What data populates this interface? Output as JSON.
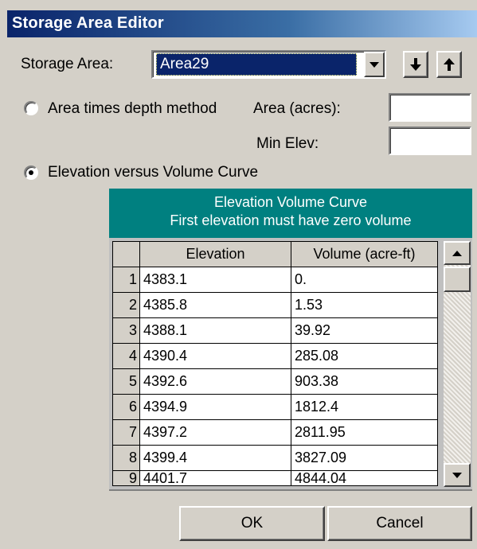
{
  "window": {
    "title": "Storage Area Editor"
  },
  "storage_area": {
    "label": "Storage Area:",
    "selected": "Area29"
  },
  "method": {
    "area_depth_label": "Area times depth method",
    "elev_volume_label": "Elevation versus Volume Curve",
    "selected": "elevation_volume"
  },
  "area_field": {
    "label": "Area (acres):",
    "value": ""
  },
  "min_elev_field": {
    "label": "Min Elev:",
    "value": ""
  },
  "grid": {
    "title_line1": "Elevation Volume Curve",
    "title_line2": "First elevation must have zero volume",
    "columns": [
      "Elevation",
      "Volume (acre-ft)"
    ],
    "rows": [
      {
        "num": "1",
        "elevation": "4383.1",
        "volume": "0."
      },
      {
        "num": "2",
        "elevation": "4385.8",
        "volume": "1.53"
      },
      {
        "num": "3",
        "elevation": "4388.1",
        "volume": "39.92"
      },
      {
        "num": "4",
        "elevation": "4390.4",
        "volume": "285.08"
      },
      {
        "num": "5",
        "elevation": "4392.6",
        "volume": "903.38"
      },
      {
        "num": "6",
        "elevation": "4394.9",
        "volume": "1812.4"
      },
      {
        "num": "7",
        "elevation": "4397.2",
        "volume": "2811.95"
      },
      {
        "num": "8",
        "elevation": "4399.4",
        "volume": "3827.09"
      },
      {
        "num": "9",
        "elevation": "4401.7",
        "volume": "4844.04"
      }
    ]
  },
  "buttons": {
    "ok": "OK",
    "cancel": "Cancel"
  },
  "icons": {
    "dropdown": "chevron-down-icon",
    "move_down": "arrow-down-icon",
    "move_up": "arrow-up-icon",
    "scroll_up": "scroll-up-icon",
    "scroll_down": "scroll-down-icon"
  },
  "colors": {
    "title_bar": "#0a246a",
    "grid_header": "#008080",
    "selection": "#0a246a",
    "face": "#d4d0c8"
  }
}
